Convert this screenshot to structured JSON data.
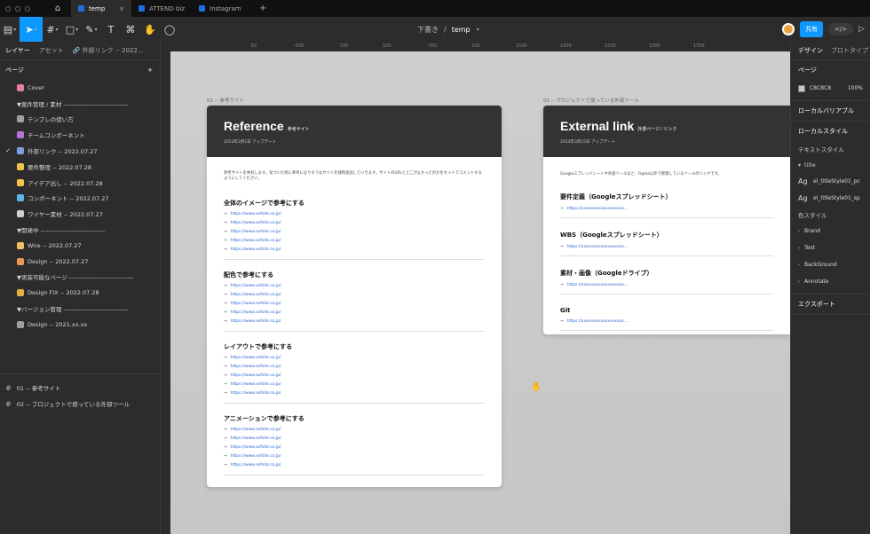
{
  "tabbar": {
    "tabs": [
      {
        "label": "temp",
        "active": true
      },
      {
        "label": "ATTEND biz",
        "active": false
      },
      {
        "label": "Instagram",
        "active": false
      }
    ],
    "close_glyph": "×",
    "add_glyph": "+"
  },
  "toolbar": {
    "breadcrumb_draft": "下書き",
    "breadcrumb_sep": "/",
    "file_name": "temp",
    "share_label": "共有",
    "code_label": "</>"
  },
  "left_panel": {
    "tab_layers": "レイヤー",
    "tab_assets": "アセット",
    "external_link": "外部リンク -- 2022...",
    "pages_title": "ページ",
    "add_glyph": "+",
    "pages": [
      {
        "label": "Cover",
        "icon_color": "#e37e9c",
        "checked": false
      },
      {
        "label": "▼案件管理 / 素材 -------------------------------",
        "icon_color": "",
        "checked": false
      },
      {
        "label": "テンプレの使い方",
        "icon_color": "#a0a0a0",
        "checked": false
      },
      {
        "label": "チームコンポーネント",
        "icon_color": "#b873d9",
        "checked": false
      },
      {
        "label": "外部リンク -- 2022.07.27",
        "icon_color": "#7aa0e0",
        "checked": true
      },
      {
        "label": "要件整理 -- 2022.07.28",
        "icon_color": "#f2c14e",
        "checked": false
      },
      {
        "label": "アイデア出し -- 2022.07.28",
        "icon_color": "#f2c14e",
        "checked": false
      },
      {
        "label": "コンポーネント -- 2022.07.27",
        "icon_color": "#56b7e8",
        "checked": false
      },
      {
        "label": "ワイヤー素材 -- 2022.07.27",
        "icon_color": "#d0d0d0",
        "checked": false
      },
      {
        "label": "▼開発中 -------------------------------",
        "icon_color": "",
        "checked": false
      },
      {
        "label": "Wire -- 2022.07.27",
        "icon_color": "#f0c060",
        "checked": false
      },
      {
        "label": "Design -- 2022.07.27",
        "icon_color": "#e89a50",
        "checked": false
      },
      {
        "label": "▼実装可能なページ -------------------------------",
        "icon_color": "",
        "checked": false
      },
      {
        "label": "Design FIX -- 2022.07.28",
        "icon_color": "#e0b040",
        "checked": false
      },
      {
        "label": "▼バージョン管理 -------------------------------",
        "icon_color": "",
        "checked": false
      },
      {
        "label": "Design -- 2021.xx.xx",
        "icon_color": "#a0a0a0",
        "checked": false
      }
    ],
    "layers": [
      {
        "label": "01 -- 参考サイト"
      },
      {
        "label": "02 -- プロジェクトで使っている外部ツール"
      }
    ]
  },
  "canvas": {
    "ruler_ticks": [
      "-50",
      "-500",
      "-150",
      "100",
      "-350",
      "100",
      "1500",
      "1000",
      "1250",
      "1500",
      "1700"
    ],
    "frame1_label": "01 -- 参考サイト",
    "frame2_label": "02 -- プロジェクトで使っている外部ツール",
    "reference": {
      "title": "Reference",
      "subtitle": "参考サイト",
      "updated": "2023年3月1日 アップデート",
      "intro": "参考サイトを共有します。気づいた時に参考になりそうなサイトを随時追加していきます。サイトのURLとどこがよかったのかをセットでコメントするようにしてください。",
      "link_prefix": "→",
      "sections": [
        {
          "heading": "全体のイメージで参考にする",
          "links": [
            "https://www.xxfsite.co.jp/",
            "https://www.xxfsite.co.jp/",
            "https://www.xxfsite.co.jp/",
            "https://www.xxfsite.co.jp/",
            "https://www.xxfsite.co.jp/"
          ]
        },
        {
          "heading": "配色で参考にする",
          "links": [
            "https://www.xxfsite.co.jp/",
            "https://www.xxfsite.co.jp/",
            "https://www.xxfsite.co.jp/",
            "https://www.xxfsite.co.jp/",
            "https://www.xxfsite.co.jp/"
          ]
        },
        {
          "heading": "レイアウトで参考にする",
          "links": [
            "https://www.xxfsite.co.jp/",
            "https://www.xxfsite.co.jp/",
            "https://www.xxfsite.co.jp/",
            "https://www.xxfsite.co.jp/",
            "https://www.xxfsite.co.jp/"
          ]
        },
        {
          "heading": "アニメーションで参考にする",
          "links": [
            "https://www.xxfsite.co.jp/",
            "https://www.xxfsite.co.jp/",
            "https://www.xxfsite.co.jp/",
            "https://www.xxfsite.co.jp/",
            "https://www.xxfsite.co.jp/"
          ]
        }
      ]
    },
    "external": {
      "title": "External link",
      "subtitle": "外部ページ / リンク",
      "updated": "2023年3月15日 アップデート",
      "intro": "Googleスプレッドシートや外部ツールなど、Figma以外で管理しているツールのリンクです。",
      "link_prefix": "→",
      "sections": [
        {
          "heading": "要件定義（Googleスプレッドシート）",
          "links": [
            "https://xxxxxxxxxxxxxxxxxx..."
          ]
        },
        {
          "heading": "WBS（Googleスプレッドシート）",
          "links": [
            "https://xxxxxxxxxxxxxxxxxx..."
          ]
        },
        {
          "heading": "素材・画像（Googleドライブ）",
          "links": [
            "https://xxxxxxxxxxxxxxxxxx..."
          ]
        },
        {
          "heading": "Git",
          "links": [
            "https://xxxxxxxxxxxxxxxxxx..."
          ]
        }
      ]
    }
  },
  "right_panel": {
    "tab_design": "デザイン",
    "tab_prototype": "プロトタイプ",
    "page_title": "ページ",
    "bg_hex": "C8C8C8",
    "bg_opacity": "100%",
    "bg_color": "#c8c8c8",
    "local_variables": "ローカルバリアブル",
    "local_styles": "ローカルスタイル",
    "text_styles": "テキストスタイル",
    "text_group": "title",
    "text_styles_items": [
      "el_titleStyle01_pc",
      "el_titleStyle01_sp"
    ],
    "ag_glyph": "Ag",
    "color_styles": "色スタイル",
    "color_items": [
      "Brand",
      "Text",
      "BackGround",
      "Annotate"
    ],
    "export": "エクスポート"
  }
}
